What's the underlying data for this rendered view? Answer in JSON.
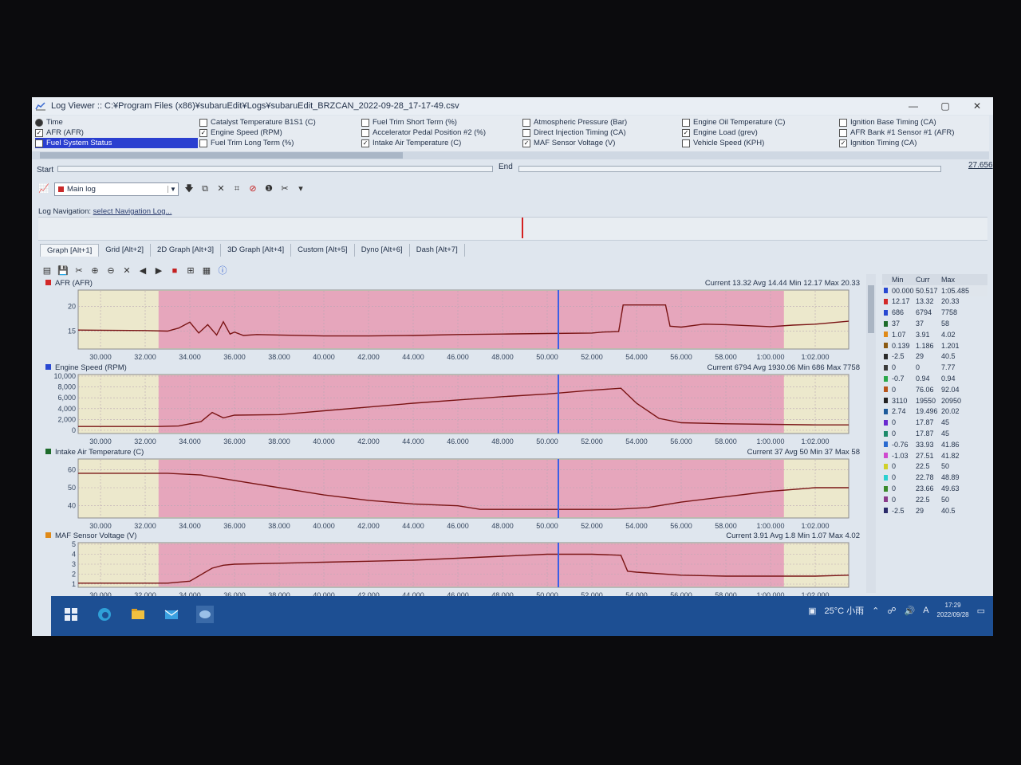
{
  "window": {
    "title": "Log Viewer :: C:¥Program Files (x86)¥subaruEdit¥Logs¥subaruEdit_BRZCAN_2022-09-28_17-17-49.csv",
    "minimize": "—",
    "maximize": "▢",
    "close": "✕"
  },
  "channels": {
    "col1": [
      {
        "label": "Time",
        "checked": false,
        "icon": "clock-icon"
      },
      {
        "label": "AFR (AFR)",
        "checked": true
      },
      {
        "label": "Fuel System Status",
        "checked": false,
        "selected": true
      }
    ],
    "col2": [
      {
        "label": "Catalyst Temperature B1S1 (C)",
        "checked": false
      },
      {
        "label": "Engine Speed (RPM)",
        "checked": true
      },
      {
        "label": "Fuel Trim Long Term (%)",
        "checked": false
      }
    ],
    "col3": [
      {
        "label": "Fuel Trim Short Term (%)",
        "checked": false
      },
      {
        "label": "Accelerator Pedal Position #2 (%)",
        "checked": false
      },
      {
        "label": "Intake Air Temperature (C)",
        "checked": true
      }
    ],
    "col4": [
      {
        "label": "Atmospheric Pressure (Bar)",
        "checked": false
      },
      {
        "label": "Direct Injection Timing (CA)",
        "checked": false
      },
      {
        "label": "MAF Sensor Voltage (V)",
        "checked": true
      }
    ],
    "col5": [
      {
        "label": "Engine Oil Temperature (C)",
        "checked": false
      },
      {
        "label": "Engine Load (grev)",
        "checked": true
      },
      {
        "label": "Vehicle Speed (KPH)",
        "checked": false
      }
    ],
    "col6": [
      {
        "label": "Ignition Base Timing (CA)",
        "checked": false
      },
      {
        "label": "AFR Bank #1 Sensor #1 (AFR)",
        "checked": false
      },
      {
        "label": "Ignition Timing (CA)",
        "checked": true
      }
    ]
  },
  "controls": {
    "start_label": "Start",
    "end_label": "End",
    "end_value": "27.656",
    "log_select": "Main log",
    "nav_label": "Log Navigation:",
    "nav_link": "select Navigation Log..."
  },
  "tabs": [
    "Graph [Alt+1]",
    "Grid [Alt+2]",
    "2D Graph [Alt+3]",
    "3D Graph [Alt+4]",
    "Custom [Alt+5]",
    "Dyno [Alt+6]",
    "Dash [Alt+7]"
  ],
  "x_tick_labels": [
    "30.000",
    "32.000",
    "34.000",
    "36.000",
    "38.000",
    "40.000",
    "42.000",
    "44.000",
    "46.000",
    "48.000",
    "50.000",
    "52.000",
    "54.000",
    "56.000",
    "58.000",
    "1:00.000",
    "1:02.000"
  ],
  "colors": {
    "afr": "#d22828",
    "rpm": "#2848d2",
    "iat": "#1d6b2a",
    "maf": "#e08a18",
    "trace": "#7a1414",
    "highlight": "#e59ab8",
    "cursor": "#3a5ee6"
  },
  "chart_data": [
    {
      "type": "line",
      "title": "AFR (AFR)",
      "stats": "Current 13.32 Avg 14.44 Min 12.17 Max 20.33",
      "y_ticks": [
        "20",
        "15"
      ],
      "ylim": [
        12,
        23
      ],
      "xlim": [
        29,
        63.5
      ],
      "highlight_range": [
        32.6,
        60.6
      ],
      "cursor_x": 50.5,
      "x": [
        29,
        32,
        33,
        33.5,
        34,
        34.4,
        34.8,
        35.2,
        35.5,
        35.8,
        36,
        36.4,
        37,
        38,
        40,
        42,
        44,
        46,
        48,
        50,
        52,
        52.5,
        53.2,
        53.4,
        55.3,
        55.5,
        56,
        57,
        58,
        60,
        61,
        62,
        63.5
      ],
      "values": [
        15.2,
        15.1,
        15.0,
        15.6,
        16.8,
        14.6,
        16.3,
        14.2,
        16.9,
        14.4,
        14.8,
        14.1,
        14.3,
        14.2,
        14.0,
        14.0,
        14.1,
        14.3,
        14.4,
        14.5,
        14.6,
        14.8,
        14.9,
        20.3,
        20.3,
        16.0,
        15.8,
        16.4,
        16.3,
        15.9,
        16.2,
        16.4,
        17.0
      ]
    },
    {
      "type": "line",
      "title": "Engine Speed (RPM)",
      "stats": "Current 6794 Avg 1930.06 Min 686 Max 7758",
      "y_ticks": [
        "10,000",
        "8,000",
        "6,000",
        "4,000",
        "2,000",
        "0"
      ],
      "ylim": [
        0,
        10000
      ],
      "xlim": [
        29,
        63.5
      ],
      "highlight_range": [
        32.6,
        60.6
      ],
      "cursor_x": 50.5,
      "x": [
        29,
        32.6,
        33.5,
        34.5,
        35,
        35.5,
        36,
        38,
        40,
        42,
        44,
        46,
        48,
        50,
        52,
        53.3,
        54,
        55,
        56,
        58,
        60,
        62,
        63.5
      ],
      "values": [
        700,
        700,
        800,
        1600,
        3300,
        2300,
        2800,
        2900,
        3600,
        4300,
        5000,
        5600,
        6200,
        6700,
        7400,
        7758,
        5000,
        2200,
        1400,
        1200,
        1100,
        1000,
        1000
      ]
    },
    {
      "type": "line",
      "title": "Intake Air Temperature (C)",
      "stats": "Current 37 Avg 50 Min 37 Max 58",
      "y_ticks": [
        "60",
        "50",
        "40"
      ],
      "ylim": [
        35,
        65
      ],
      "xlim": [
        29,
        63.5
      ],
      "highlight_range": [
        32.6,
        60.6
      ],
      "cursor_x": 50.5,
      "x": [
        29,
        33,
        34.5,
        36,
        38,
        40,
        42,
        44,
        46,
        47,
        50,
        53,
        54.5,
        56,
        58,
        60,
        62,
        63.5
      ],
      "values": [
        58,
        58,
        57,
        54,
        50,
        46,
        43,
        41,
        40,
        38,
        38,
        38,
        39,
        42,
        45,
        48,
        50,
        50
      ]
    },
    {
      "type": "line",
      "title": "MAF Sensor Voltage (V)",
      "stats": "Current 3.91 Avg 1.8 Min 1.07 Max 4.02",
      "y_ticks": [
        "5",
        "4",
        "3",
        "2",
        "1"
      ],
      "ylim": [
        1,
        5
      ],
      "xlim": [
        29,
        63.5
      ],
      "highlight_range": [
        32.6,
        60.6
      ],
      "cursor_x": 50.5,
      "x": [
        29,
        33,
        34,
        35,
        35.5,
        36,
        38,
        40,
        42,
        44,
        46,
        48,
        50,
        52,
        53.3,
        53.6,
        54,
        56,
        58,
        60,
        62,
        63.5
      ],
      "values": [
        1.1,
        1.1,
        1.3,
        2.6,
        2.9,
        3.0,
        3.1,
        3.2,
        3.3,
        3.4,
        3.6,
        3.8,
        4.0,
        4.0,
        3.9,
        2.3,
        2.2,
        1.9,
        1.8,
        1.8,
        1.8,
        1.9
      ]
    }
  ],
  "stats_table": {
    "headers": [
      "Min",
      "Curr",
      "Max"
    ],
    "rows": [
      {
        "min": "00.000",
        "curr": "50.517",
        "max": "1:05.485",
        "color": "#2848d2",
        "selected": true
      },
      {
        "min": "12.17",
        "curr": "13.32",
        "max": "20.33",
        "color": "#d22828"
      },
      {
        "min": "686",
        "curr": "6794",
        "max": "7758",
        "color": "#2848d2"
      },
      {
        "min": "37",
        "curr": "37",
        "max": "58",
        "color": "#1d6b2a"
      },
      {
        "min": "1.07",
        "curr": "3.91",
        "max": "4.02",
        "color": "#e08a18"
      },
      {
        "min": "0.139",
        "curr": "1.186",
        "max": "1.201",
        "color": "#8b5a14"
      },
      {
        "min": "-2.5",
        "curr": "29",
        "max": "40.5",
        "color": "#2a2a2a"
      },
      {
        "min": "0",
        "curr": "0",
        "max": "7.77",
        "color": "#3a3a3a"
      },
      {
        "min": "-0.7",
        "curr": "0.94",
        "max": "0.94",
        "color": "#2aa84a"
      },
      {
        "min": "0",
        "curr": "76.06",
        "max": "92.04",
        "color": "#b8541a"
      },
      {
        "min": "3110",
        "curr": "19550",
        "max": "20950",
        "color": "#222222"
      },
      {
        "min": "2.74",
        "curr": "19.496",
        "max": "20.02",
        "color": "#1d5a9a"
      },
      {
        "min": "0",
        "curr": "17.87",
        "max": "45",
        "color": "#6a2ad0"
      },
      {
        "min": "0",
        "curr": "17.87",
        "max": "45",
        "color": "#1d8a6a"
      },
      {
        "min": "-0.76",
        "curr": "33.93",
        "max": "41.86",
        "color": "#2a6ad0"
      },
      {
        "min": "-1.03",
        "curr": "27.51",
        "max": "41.82",
        "color": "#d04ad0"
      },
      {
        "min": "0",
        "curr": "22.5",
        "max": "50",
        "color": "#d0d02a"
      },
      {
        "min": "0",
        "curr": "22.78",
        "max": "48.89",
        "color": "#2ad0d0"
      },
      {
        "min": "0",
        "curr": "23.66",
        "max": "49.63",
        "color": "#3a8a2a"
      },
      {
        "min": "0",
        "curr": "22.5",
        "max": "50",
        "color": "#8a3a8a"
      },
      {
        "min": "-2.5",
        "curr": "29",
        "max": "40.5",
        "color": "#2a2a6a"
      }
    ]
  },
  "taskbar": {
    "weather": "25°C 小雨",
    "ime": "A",
    "time": "17:29",
    "date": "2022/09/28"
  }
}
